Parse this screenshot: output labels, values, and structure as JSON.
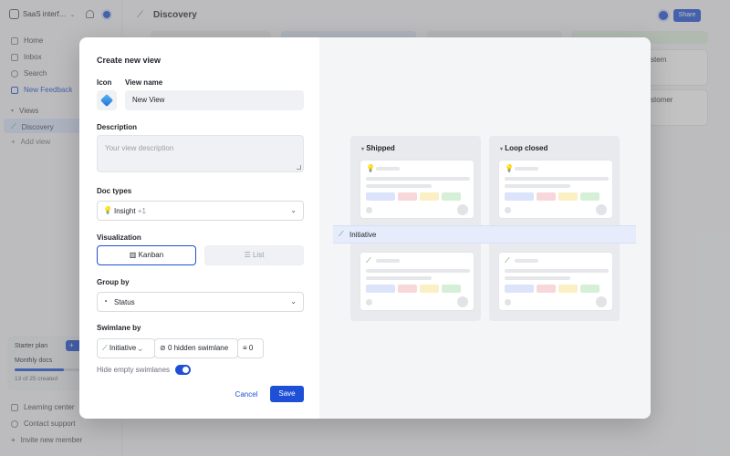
{
  "sidebar": {
    "workspace": "SaaS interf…",
    "nav": [
      {
        "label": "Home"
      },
      {
        "label": "Inbox"
      },
      {
        "label": "Search"
      },
      {
        "label": "New Feedback"
      },
      {
        "label": "Views"
      },
      {
        "label": "Discovery"
      },
      {
        "label": "Add view"
      }
    ],
    "starter_plan": {
      "title": "Starter plan",
      "button": "+",
      "label": "Monthly docs",
      "progress": 0.52,
      "count": "13 of 25 created"
    },
    "footer": [
      {
        "label": "Learning center"
      },
      {
        "label": "Contact support"
      },
      {
        "label": "Invite new member"
      }
    ]
  },
  "topbar": {
    "title": "Discovery",
    "share": "Share"
  },
  "background": {
    "cards": [
      "stem",
      "stomer"
    ]
  },
  "modal": {
    "title": "Create new view",
    "icon_label": "Icon",
    "name_label": "View name",
    "name_value": "New View",
    "description_label": "Description",
    "description_placeholder": "Your view description",
    "doc_types_label": "Doc types",
    "doc_types_value": "Insight",
    "doc_types_extra": "+1",
    "visualization_label": "Visualization",
    "vis_kanban": "Kanban",
    "vis_list": "List",
    "group_by_label": "Group by",
    "group_by_value": "Status",
    "swimlane_label": "Swimlane by",
    "swimlane_value": "Initiative",
    "hidden_swimlane": "0 hidden swimlane",
    "filter_count": "0",
    "hide_empty_label": "Hide empty swimlanes",
    "hide_empty_on": true,
    "cancel": "Cancel",
    "save": "Save"
  },
  "preview": {
    "columns": [
      "Shipped",
      "Loop closed"
    ],
    "swimlane": "Initiative",
    "tag_colors": [
      "#dbe4fb",
      "#f8d7da",
      "#fbefc4",
      "#d6f0d8"
    ]
  }
}
